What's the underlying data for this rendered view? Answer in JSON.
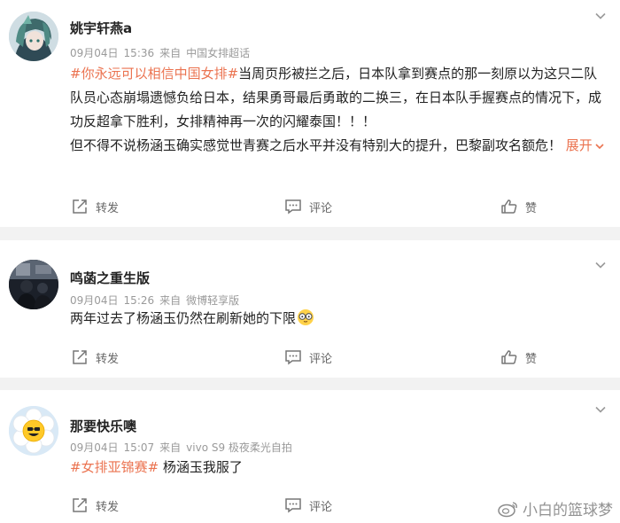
{
  "posts": [
    {
      "username": "姚宇轩燕a",
      "date": "09月04日",
      "time": "15:36",
      "source_prefix": "来自",
      "source": "中国女排超话",
      "tag": "#你永远可以相信中国女排#",
      "body": "当周页彤被拦之后，日本队拿到赛点的那一刻原以为这只二队队员心态崩塌遗憾负给日本，结果勇哥最后勇敢的二换三，在日本队手握赛点的情况下，成功反超拿下胜利，女排精神再一次的闪耀泰国！！！",
      "body2": "但不得不说杨涵玉确实感觉世青赛之后水平并没有特别大的提升，巴黎副攻名额危！",
      "expand_label": "展开",
      "share_label": "转发",
      "comment_label": "评论",
      "like_label": "赞"
    },
    {
      "username": "鸣菡之重生版",
      "date": "09月04日",
      "time": "15:26",
      "source_prefix": "来自",
      "source": "微博轻享版",
      "body": "两年过去了杨涵玉仍然在刷新她的下限",
      "emoji": "glasses-emoji",
      "share_label": "转发",
      "comment_label": "评论",
      "like_label": "赞"
    },
    {
      "username": "那要快乐噢",
      "date": "09月04日",
      "time": "15:07",
      "source_prefix": "来自",
      "source": "vivo S9 极夜柔光自拍",
      "tag": "#女排亚锦赛#",
      "body": "杨涵玉我服了",
      "share_label": "转发",
      "comment_label": "评论",
      "like_label": ""
    }
  ],
  "watermark": "小白的篮球梦",
  "colors": {
    "accent": "#eb7350",
    "meta": "#9a9a9a",
    "separator": "#f2f2f2"
  }
}
